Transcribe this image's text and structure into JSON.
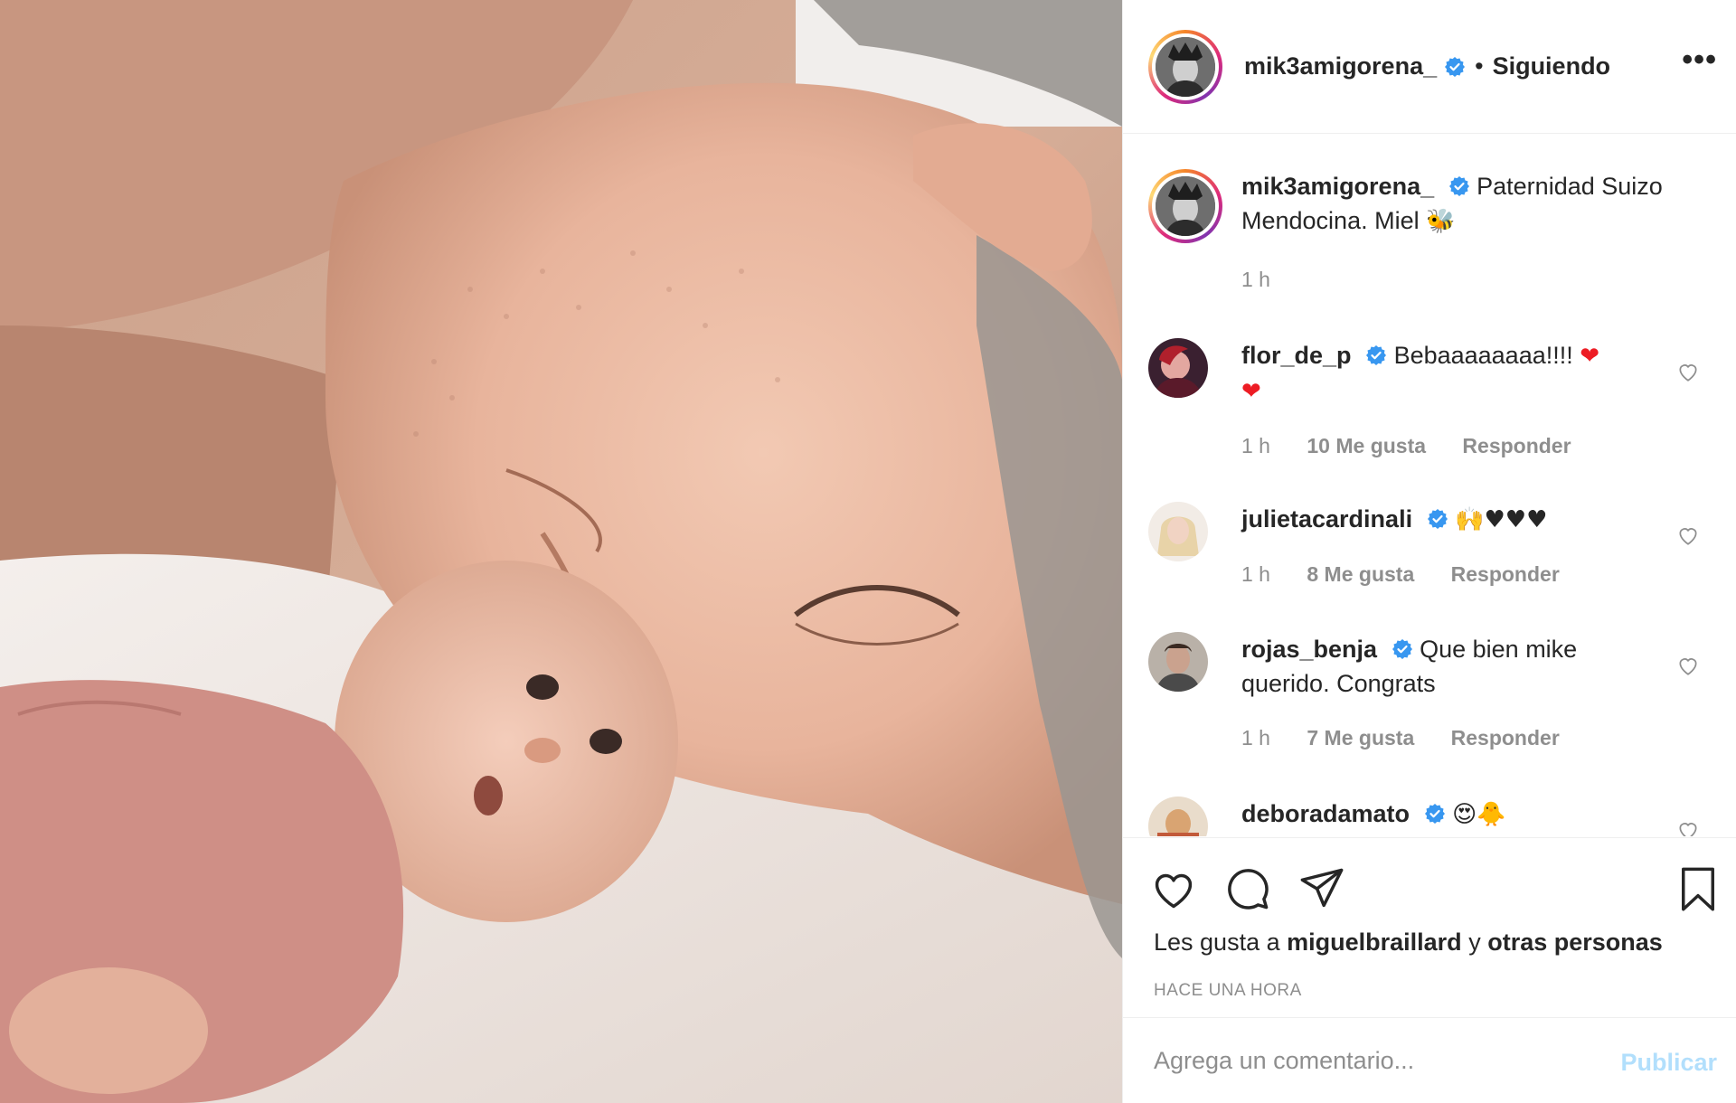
{
  "post": {
    "author": "mik3amigorena_",
    "following_label": "Siguiendo",
    "separator": "•",
    "more_label": "•••"
  },
  "caption": {
    "username": "mik3amigorena_",
    "text": "Paternidad Suizo Mendocina. Miel",
    "emoji": "🐝",
    "time": "1 h"
  },
  "comments": [
    {
      "username": "flor_de_p",
      "text": "Bebaaaaaaaa!!!!",
      "emoji_inline": "❤",
      "emoji_line2": "❤",
      "time": "1 h",
      "likes": "10 Me gusta",
      "reply": "Responder"
    },
    {
      "username": "julietacardinali",
      "text": "🙌♥♥♥",
      "time": "1 h",
      "likes": "8 Me gusta",
      "reply": "Responder"
    },
    {
      "username": "rojas_benja",
      "text": "Que bien mike querido. Congrats",
      "time": "1 h",
      "likes": "7 Me gusta",
      "reply": "Responder"
    },
    {
      "username": "deboradamato",
      "text": "😍🐥"
    }
  ],
  "actions": {
    "likes_prefix": "Les gusta a",
    "likes_user": "miguelbraillard",
    "likes_mid": "y",
    "likes_others": "otras personas",
    "timestamp": "HACE UNA HORA"
  },
  "add_comment": {
    "placeholder": "Agrega un comentario...",
    "publish": "Publicar"
  },
  "colors": {
    "verified": "#3897f0",
    "publish_disabled": "#b2dffc",
    "muted": "#8e8e8e"
  }
}
